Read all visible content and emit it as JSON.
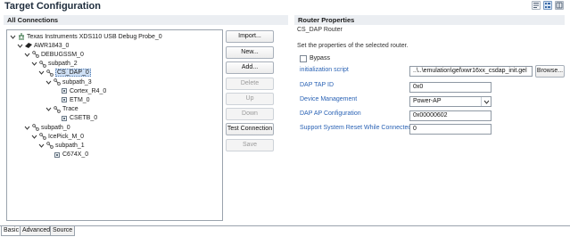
{
  "window": {
    "title": "Target Configuration"
  },
  "toolbar": {
    "icons": [
      "source-view-icon",
      "form-view-icon",
      "advanced-view-icon"
    ]
  },
  "connections": {
    "header": "All Connections",
    "tree": [
      {
        "label": "Texas Instruments XDS110 USB Debug Probe_0",
        "icon": "probe-icon",
        "level": 0,
        "expanded": true
      },
      {
        "label": "AWR1843_0",
        "icon": "chip-icon",
        "level": 1,
        "expanded": true
      },
      {
        "label": "DEBUGSSM_0",
        "icon": "route-icon",
        "level": 2,
        "expanded": true
      },
      {
        "label": "subpath_2",
        "icon": "route-icon",
        "level": 3,
        "expanded": true
      },
      {
        "label": "CS_DAP_0",
        "icon": "route-icon",
        "level": 4,
        "expanded": true,
        "selected": true
      },
      {
        "label": "subpath_3",
        "icon": "route-icon",
        "level": 5,
        "expanded": true
      },
      {
        "label": "Cortex_R4_0",
        "icon": "cpu-icon",
        "level": 6,
        "expanded": false
      },
      {
        "label": "ETM_0",
        "icon": "cpu-icon",
        "level": 6,
        "expanded": false
      },
      {
        "label": "Trace",
        "icon": "route-icon",
        "level": 5,
        "expanded": true
      },
      {
        "label": "CSETB_0",
        "icon": "cpu-icon",
        "level": 6,
        "expanded": false
      },
      {
        "label": "subpath_0",
        "icon": "route-icon",
        "level": 2,
        "expanded": true
      },
      {
        "label": "IcePick_M_0",
        "icon": "route-icon",
        "level": 3,
        "expanded": true
      },
      {
        "label": "subpath_1",
        "icon": "route-icon",
        "level": 4,
        "expanded": true
      },
      {
        "label": "C674X_0",
        "icon": "cpu-icon",
        "level": 5,
        "expanded": false
      }
    ],
    "buttons": [
      {
        "label": "Import...",
        "enabled": true
      },
      {
        "label": "New...",
        "enabled": true
      },
      {
        "label": "Add...",
        "enabled": true
      },
      {
        "label": "Delete",
        "enabled": false
      },
      {
        "label": "Up",
        "enabled": false
      },
      {
        "label": "Down",
        "enabled": false
      },
      {
        "label": "Test Connection",
        "enabled": true
      },
      {
        "label": "Save",
        "enabled": false
      }
    ]
  },
  "properties": {
    "header": "Router Properties",
    "subtitle": "CS_DAP Router",
    "description": "Set the properties of the selected router.",
    "bypass_label": "Bypass",
    "bypass_checked": false,
    "init_script_label": "initialization script",
    "init_script_value": "..\\..\\emulation\\gel\\xwr16xx_csdap_init.gel",
    "browse_label": "Browse...",
    "dap_tap_id_label": "DAP TAP ID",
    "dap_tap_id_value": "0x0",
    "device_mgmt_label": "Device Management",
    "device_mgmt_value": "Power-AP",
    "dap_ap_config_label": "DAP AP Configuration",
    "dap_ap_config_value": "0x00000602",
    "support_reset_label": "Support System Reset While Connected",
    "support_reset_value": "0"
  },
  "tabs": [
    {
      "label": "Basic",
      "active": true
    },
    {
      "label": "Advanced",
      "active": false
    },
    {
      "label": "Source",
      "active": false
    }
  ]
}
